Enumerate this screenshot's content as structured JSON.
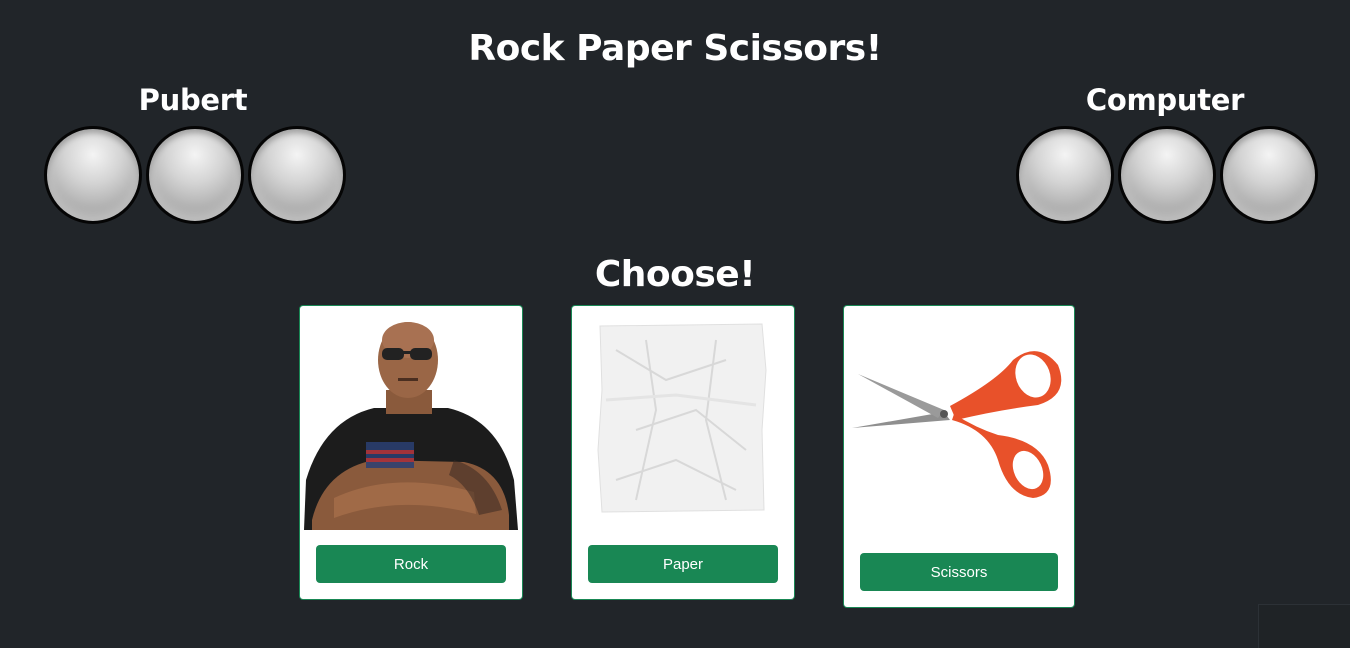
{
  "header": {
    "title": "Rock Paper Scissors!"
  },
  "players": {
    "left": {
      "name": "Pubert",
      "lives": 3
    },
    "right": {
      "name": "Computer",
      "lives": 3
    }
  },
  "prompt": "Choose!",
  "choices": [
    {
      "label": "Rock",
      "image": "rock-person-image"
    },
    {
      "label": "Paper",
      "image": "crumpled-paper-image"
    },
    {
      "label": "Scissors",
      "image": "scissors-image"
    }
  ],
  "colors": {
    "background": "#212529",
    "button": "#198754",
    "scissors_handle": "#e8512a"
  }
}
